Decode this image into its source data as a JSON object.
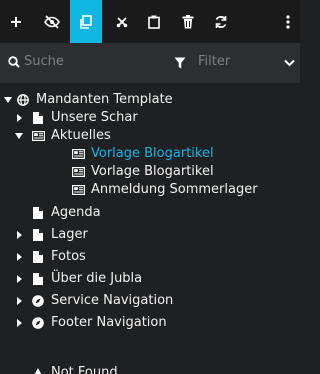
{
  "toolbar": {
    "buttons": [
      {
        "icon": "add-icon"
      },
      {
        "icon": "hide-icon"
      },
      {
        "icon": "copy-icon",
        "active": true
      },
      {
        "icon": "cut-icon"
      },
      {
        "icon": "paste-icon"
      },
      {
        "icon": "delete-icon"
      },
      {
        "icon": "refresh-icon"
      },
      {
        "icon": "more-icon"
      }
    ],
    "accent": "#0fb6e0"
  },
  "search": {
    "placeholder": "Suche"
  },
  "filter": {
    "label": "Filter"
  },
  "tree": {
    "root": {
      "label": "Mandanten Template"
    },
    "items": [
      {
        "label": "Unsere Schar"
      },
      {
        "label": "Aktuelles"
      },
      {
        "label": "Vorlage Blogartikel",
        "active": true
      },
      {
        "label": "Vorlage Blogartikel"
      },
      {
        "label": "Anmeldung Sommerlager"
      },
      {
        "label": "Agenda"
      },
      {
        "label": "Lager"
      },
      {
        "label": "Fotos"
      },
      {
        "label": "Über die Jubla"
      },
      {
        "label": "Service Navigation"
      },
      {
        "label": "Footer Navigation"
      },
      {
        "label": "Not Found"
      }
    ],
    "active_color": "#18b5e8"
  }
}
